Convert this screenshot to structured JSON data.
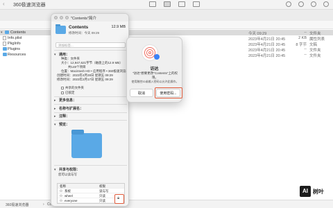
{
  "finder": {
    "window_title": "360极速浏览器",
    "columns": [],
    "rows": [
      {
        "name": "Contents",
        "date": "今天 09:29",
        "size": "--",
        "kind": "文件夹",
        "type": "folder",
        "selected": true
      },
      {
        "name": "Info.plist",
        "date": "2023年4月21日 20:45",
        "size": "2 KB",
        "kind": "属性列表",
        "type": "doc"
      },
      {
        "name": "PkgInfo",
        "date": "2023年4月21日 20:45",
        "size": "8 字节",
        "kind": "文稿",
        "type": "doc"
      },
      {
        "name": "Plugins",
        "date": "2023年4月21日 20:45",
        "size": "--",
        "kind": "文件夹",
        "type": "folder"
      },
      {
        "name": "Resources",
        "date": "2023年4月21日 20:45",
        "size": "--",
        "kind": "文件夹",
        "type": "folder"
      }
    ],
    "path": [
      "360极速浏览器",
      "Contents"
    ]
  },
  "info": {
    "title": "\"Contents\"简介",
    "name": "Contents",
    "size": "12.9 MB",
    "modified": "修改时间：今天 09:29",
    "sections": {
      "tags_label": "添加标签...",
      "general": "通用：",
      "general_lines": [
        "种类：文件夹",
        "大小：12,947,621字节（磁盘上的12.9 MB）",
        "共148个项目",
        "位置：Macintosh HD • 应用程序 • 360极速浏览器",
        "创建时间：2023年4月28日 星期五 09:29",
        "修改时间：2023年2月17日 星期五 09:29"
      ],
      "shared_folder": "共享的文件夹",
      "locked": "已锁定",
      "more_info": "更多信息：",
      "name_ext": "名称与扩展名：",
      "comments": "注释：",
      "preview": "预览：",
      "sharing": "共享与权限：",
      "sharing_note": "您可以读与写",
      "perm_header": [
        "名称",
        "权限"
      ],
      "perms": [
        {
          "name": "系统",
          "perm": "读与写"
        },
        {
          "name": "wheel",
          "perm": "只读"
        },
        {
          "name": "everyone",
          "perm": "只读"
        }
      ]
    }
  },
  "dialog": {
    "title": "访达",
    "message": "\"访达\"想要更改\"Contents\"上的权限。",
    "hint": "使用触控ID或输入密码以允许此操作。",
    "cancel": "取消",
    "use_password": "使用密码..."
  },
  "watermark": {
    "box": "AI",
    "text": "树叶"
  }
}
